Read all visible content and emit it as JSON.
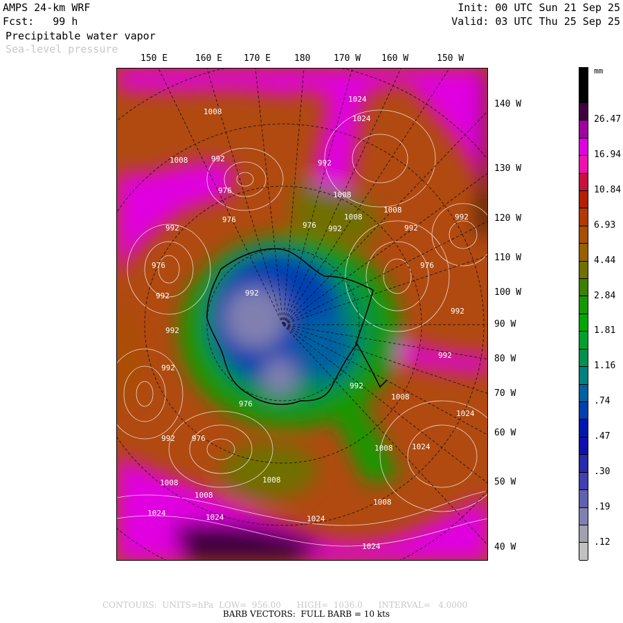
{
  "header": {
    "model": "AMPS 24-km WRF",
    "forecast": "Fcst:   99 h",
    "init": "Init: 00 UTC Sun 21 Sep 25",
    "valid": "Valid: 03 UTC Thu 25 Sep 25",
    "field": "Precipitable water vapor",
    "contour_field": "Sea-level pressure"
  },
  "longitudes": [
    "150 E",
    "160 E",
    "170 E",
    "180",
    "170 W",
    "160 W",
    "150 W"
  ],
  "latitudes": [
    "140 W",
    "130 W",
    "120 W",
    "110 W",
    "100 W",
    "90 W",
    "80 W",
    "70 W",
    "60 W",
    "50 W",
    "40 W"
  ],
  "pressure_labels": [
    "1008",
    "1024",
    "1024",
    "1008",
    "992",
    "992",
    "976",
    "1008",
    "1008",
    "976",
    "992",
    "992",
    "992",
    "1008",
    "992",
    "976",
    "976",
    "992",
    "992",
    "992",
    "992",
    "992",
    "1008",
    "992",
    "976",
    "976",
    "992",
    "1024",
    "992",
    "976",
    "1008",
    "1008",
    "1024",
    "1008",
    "1024",
    "1024",
    "1008",
    "1024",
    "1008",
    "1024"
  ],
  "colorbar": {
    "units": "mm",
    "labels": [
      "26.47",
      "16.94",
      "10.84",
      "6.93",
      "4.44",
      "2.84",
      "1.81",
      "1.16",
      ".74",
      ".47",
      ".30",
      ".19",
      ".12"
    ],
    "colors": [
      "#000000",
      "#000000",
      "#400040",
      "#a000a0",
      "#e000e0",
      "#f010b0",
      "#c81040",
      "#b42000",
      "#b43800",
      "#a85000",
      "#986000",
      "#707000",
      "#3c8000",
      "#189800",
      "#00a800",
      "#00a030",
      "#009050",
      "#008080",
      "#0060a0",
      "#0040b0",
      "#0018b0",
      "#1010b0",
      "#2828b0",
      "#4040b0",
      "#6060b0",
      "#8080b0",
      "#a0a0b0",
      "#c0c0c0"
    ]
  },
  "footer": {
    "contours": "CONTOURS:  UNITS=hPa  LOW=  956.00      HIGH=  1036.0      INTERVAL=   4.0000",
    "barbs": "BARB VECTORS:  FULL BARB = 10 kts"
  }
}
